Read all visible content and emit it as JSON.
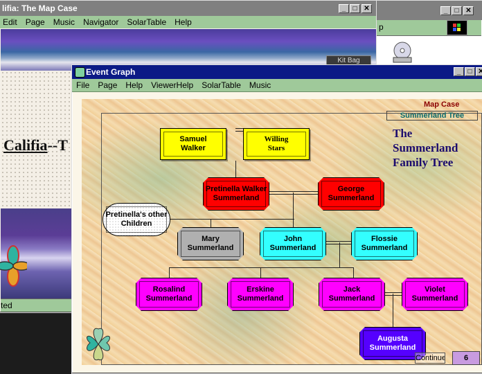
{
  "map_case_window": {
    "title": "lifia:  The Map Case",
    "menu": [
      "Edit",
      "Page",
      "Music",
      "Navigator",
      "SolarTable",
      "Help"
    ],
    "kitbag_label": "Kit Bag",
    "heading_part1": "Califia",
    "heading_part2": "--T",
    "status_text": "ted"
  },
  "right_window": {
    "partial_label": "p"
  },
  "event_graph_window": {
    "title": "Event Graph",
    "menu": [
      "File",
      "Page",
      "Help",
      "ViewerHelp",
      "SolarTable",
      "Music"
    ],
    "map_case_label": "Map Case",
    "tree_label": "Summerland Tree",
    "family_title": [
      "The",
      "Summerland",
      "Family Tree"
    ],
    "continue_label": "Continue",
    "page_number": "6"
  },
  "family_nodes": [
    {
      "id": "samuel",
      "lines": [
        "Samuel",
        "Walker"
      ],
      "color": "#ffff00"
    },
    {
      "id": "willing",
      "lines": [
        "Willing",
        "Stars"
      ],
      "color": "#ffff00"
    },
    {
      "id": "pretinella",
      "lines": [
        "Pretinella Walker",
        "Summerland"
      ],
      "color": "#ff0000"
    },
    {
      "id": "george",
      "lines": [
        "George",
        "Summerland"
      ],
      "color": "#ff0000"
    },
    {
      "id": "other-children",
      "lines": [
        "Pretinella's other",
        "Children"
      ],
      "color": "#ffffff"
    },
    {
      "id": "mary",
      "lines": [
        "Mary",
        "Summerland"
      ],
      "color": "#b0b0b0"
    },
    {
      "id": "john",
      "lines": [
        "John",
        "Summerland"
      ],
      "color": "#33ffff"
    },
    {
      "id": "flossie",
      "lines": [
        "Flossie",
        "Summerland"
      ],
      "color": "#33ffff"
    },
    {
      "id": "rosalind",
      "lines": [
        "Rosalind",
        "Summerland"
      ],
      "color": "#ff00ff"
    },
    {
      "id": "erskine",
      "lines": [
        "Erskine",
        "Summerland"
      ],
      "color": "#ff00ff"
    },
    {
      "id": "jack",
      "lines": [
        "Jack",
        "Summerland"
      ],
      "color": "#ff00ff"
    },
    {
      "id": "violet",
      "lines": [
        "Violet",
        "Summerland"
      ],
      "color": "#ff00ff"
    },
    {
      "id": "augusta",
      "lines": [
        "Augusta",
        "Summerland"
      ],
      "color": "#5500ff"
    }
  ],
  "colors": {
    "titlebar_active": "#0b1a86",
    "titlebar_inactive": "#808080",
    "menu_green": "#9fc99a",
    "family_title": "#1c0c6e",
    "map_case_text": "#8b0000",
    "tree_label_text": "#0a6b6b"
  }
}
